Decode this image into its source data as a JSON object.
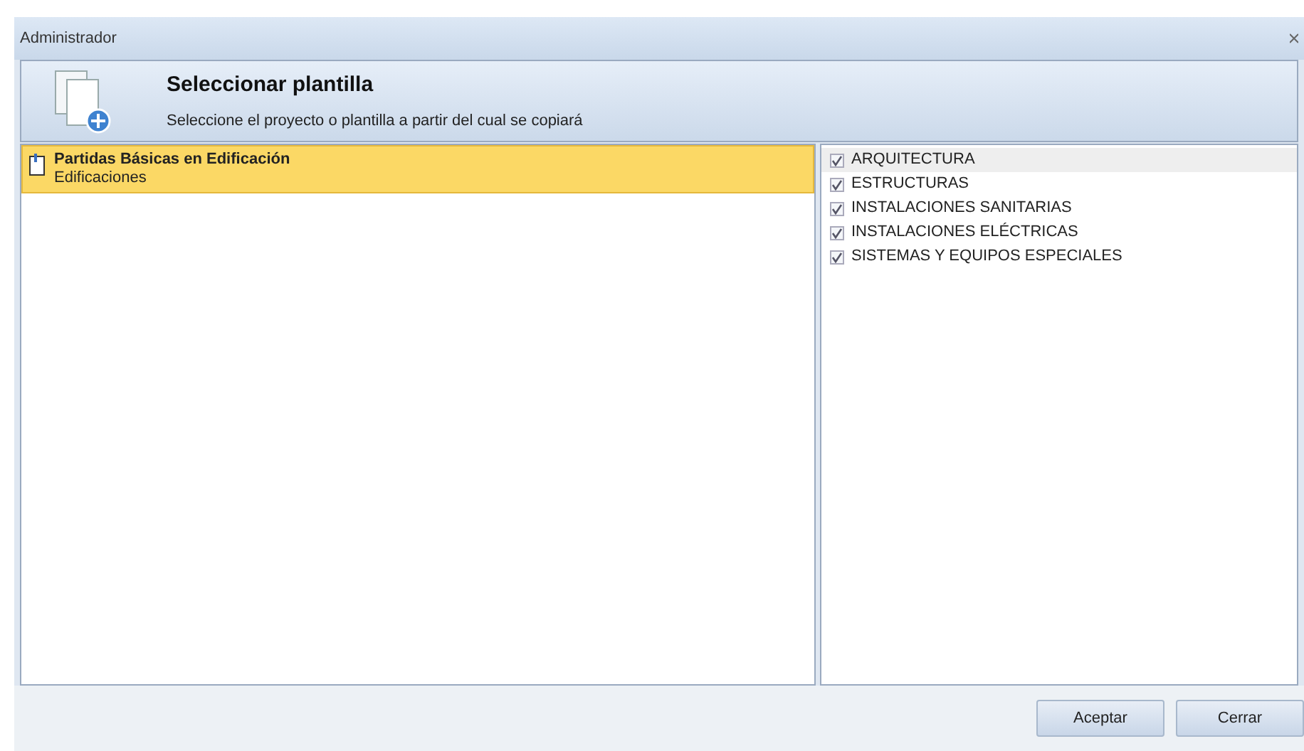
{
  "window": {
    "title": "Administrador"
  },
  "header": {
    "title": "Seleccionar plantilla",
    "subtitle": "Seleccione el proyecto o plantilla a partir del cual se copiará"
  },
  "templates": [
    {
      "name": "Partidas Básicas en Edificación",
      "category": "Edificaciones",
      "selected": true
    }
  ],
  "specialties": [
    {
      "label": "ARQUITECTURA",
      "checked": true,
      "selected": true
    },
    {
      "label": "ESTRUCTURAS",
      "checked": true,
      "selected": false
    },
    {
      "label": "INSTALACIONES SANITARIAS",
      "checked": true,
      "selected": false
    },
    {
      "label": "INSTALACIONES ELÉCTRICAS",
      "checked": true,
      "selected": false
    },
    {
      "label": "SISTEMAS Y EQUIPOS ESPECIALES",
      "checked": true,
      "selected": false
    }
  ],
  "buttons": [
    {
      "label": "Aceptar"
    },
    {
      "label": "Cerrar"
    }
  ]
}
